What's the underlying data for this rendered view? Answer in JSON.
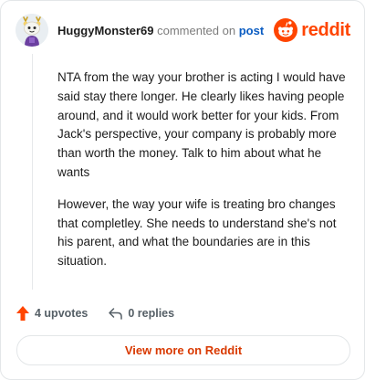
{
  "header": {
    "username": "HuggyMonster69",
    "action_text": "commented on",
    "post_link": "post",
    "logo_text": "reddit",
    "avatar_icon": "snoo-avatar-icon",
    "logo_icon": "reddit-alien-icon"
  },
  "comment": {
    "paragraphs": [
      "NTA from the way your brother is acting I would have said stay there longer. He clearly likes having people around, and it would work better for your kids. From Jack's perspective, your company is probably more than worth the money. Talk to him about what he wants",
      "However, the way your wife is treating bro changes that completley. She needs to understand she's not his parent, and what the boundaries are in this situation."
    ]
  },
  "footer": {
    "upvotes_label": "4 upvotes",
    "replies_label": "0 replies",
    "upvote_icon": "upvote-arrow-icon",
    "reply_icon": "reply-arrow-icon",
    "view_more_label": "View more on Reddit"
  },
  "colors": {
    "brand": "#ff4500",
    "link": "#0a5cc2",
    "view_more": "#d93900"
  }
}
